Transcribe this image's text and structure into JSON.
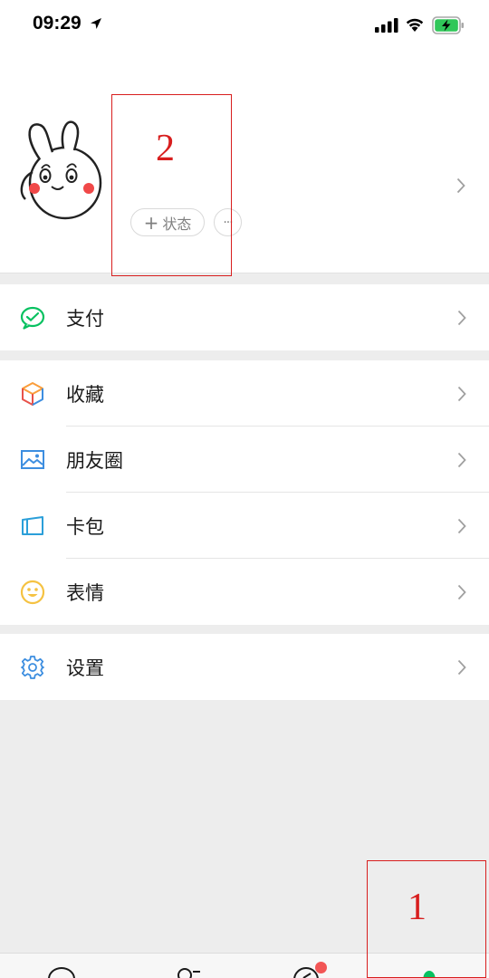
{
  "status_bar": {
    "time": "09:29"
  },
  "profile": {
    "status_button_label": "状态",
    "status_plus": "+",
    "more_label": "···"
  },
  "menu": {
    "group1": [
      {
        "label": "支付",
        "icon": "wechat-pay-icon"
      }
    ],
    "group2": [
      {
        "label": "收藏",
        "icon": "favorites-cube-icon"
      },
      {
        "label": "朋友圈",
        "icon": "moments-picture-icon"
      },
      {
        "label": "卡包",
        "icon": "card-wallet-icon"
      },
      {
        "label": "表情",
        "icon": "sticker-smiley-icon"
      }
    ],
    "group3": [
      {
        "label": "设置",
        "icon": "settings-gear-icon"
      }
    ]
  },
  "annotations": {
    "label_1": "1",
    "label_2": "2"
  },
  "tab_bar": {
    "icons": [
      "chats-icon",
      "contacts-icon",
      "discover-icon",
      "me-icon"
    ]
  },
  "colors": {
    "accent_green": "#07c160",
    "annotation_red": "#d81e1e",
    "badge_red": "#f25555",
    "background": "#ededed"
  }
}
